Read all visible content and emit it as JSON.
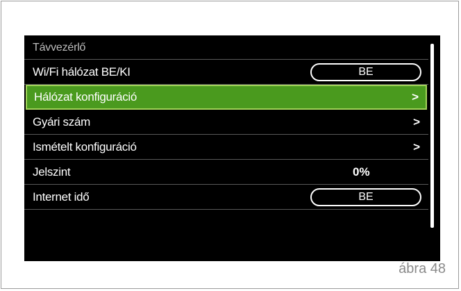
{
  "screen": {
    "section_title": "Távvezérlő",
    "rows": [
      {
        "label": "Wi/Fi hálózat BE/KI",
        "pill": "BE"
      },
      {
        "label": "Hálózat konfiguráció",
        "chevron": ">"
      },
      {
        "label": "Gyári szám",
        "chevron": ">"
      },
      {
        "label": "Ismételt konfiguráció",
        "chevron": ">"
      },
      {
        "label": "Jelszint",
        "value": "0%"
      },
      {
        "label": "Internet idő",
        "pill": "BE"
      }
    ]
  },
  "caption": "ábra 48",
  "colors": {
    "selected_bg": "#4a9a1e",
    "selected_border": "#a3d35a",
    "screen_bg": "#000000"
  }
}
